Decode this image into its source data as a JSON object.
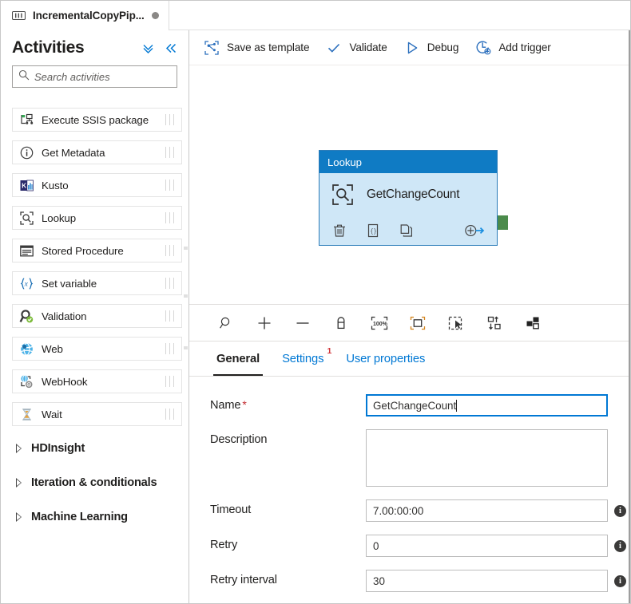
{
  "tab": {
    "title": "IncrementalCopyPip...",
    "icon": "pipeline-icon",
    "dirty_indicator": "unsaved-dot"
  },
  "sidebar": {
    "title": "Activities",
    "collapse_all_icon": "chevron-double-down-icon",
    "collapse_panel_icon": "chevron-double-left-icon",
    "search": {
      "placeholder": "Search activities",
      "value": "",
      "icon": "search-icon"
    },
    "items": [
      {
        "label": "Execute SSIS package",
        "icon": "execute-ssis-package-icon"
      },
      {
        "label": "Get Metadata",
        "icon": "get-metadata-icon"
      },
      {
        "label": "Kusto",
        "icon": "kusto-icon"
      },
      {
        "label": "Lookup",
        "icon": "lookup-icon"
      },
      {
        "label": "Stored Procedure",
        "icon": "stored-procedure-icon"
      },
      {
        "label": "Set variable",
        "icon": "set-variable-icon"
      },
      {
        "label": "Validation",
        "icon": "validation-icon"
      },
      {
        "label": "Web",
        "icon": "web-icon"
      },
      {
        "label": "WebHook",
        "icon": "webhook-icon"
      },
      {
        "label": "Wait",
        "icon": "wait-icon"
      }
    ],
    "groups": [
      {
        "label": "HDInsight",
        "expanded": false
      },
      {
        "label": "Iteration & conditionals",
        "expanded": false
      },
      {
        "label": "Machine Learning",
        "expanded": false
      }
    ]
  },
  "toolbar": {
    "commands": [
      {
        "label": "Save as template",
        "icon": "save-as-template-icon"
      },
      {
        "label": "Validate",
        "icon": "checkmark-icon"
      },
      {
        "label": "Debug",
        "icon": "play-triangle-icon"
      },
      {
        "label": "Add trigger",
        "icon": "add-trigger-icon"
      }
    ]
  },
  "canvas": {
    "node": {
      "type_label": "Lookup",
      "name": "GetChangeCount",
      "icon": "lookup-icon",
      "header_color": "#0f7bc4",
      "body_color": "#cfe7f7",
      "border_color": "#2b7cb9",
      "actions": [
        {
          "name": "delete-icon",
          "label": "Delete"
        },
        {
          "name": "code-view-icon",
          "label": "Code"
        },
        {
          "name": "clone-icon",
          "label": "Clone"
        },
        {
          "name": "add-output-icon",
          "label": "Add output"
        }
      ],
      "status_indicator": {
        "name": "error-circle",
        "color": "#e81123"
      },
      "output_handle": {
        "name": "success-output-handle",
        "color": "#4b8b4b"
      }
    },
    "tools": [
      {
        "icon": "zoom-to-fit-icon"
      },
      {
        "icon": "zoom-in-icon"
      },
      {
        "icon": "zoom-out-icon"
      },
      {
        "icon": "lock-icon"
      },
      {
        "icon": "zoom-100-percent-icon",
        "label": "100%"
      },
      {
        "icon": "fit-to-screen-icon"
      },
      {
        "icon": "select-region-icon"
      },
      {
        "icon": "auto-align-icon"
      },
      {
        "icon": "layout-icon"
      }
    ]
  },
  "properties": {
    "tabs": [
      {
        "label": "General",
        "active": true,
        "badge": null
      },
      {
        "label": "Settings",
        "active": false,
        "badge": "1"
      },
      {
        "label": "User properties",
        "active": false,
        "badge": null
      }
    ],
    "fields": [
      {
        "label": "Name",
        "required": true,
        "value": "GetChangeCount",
        "placeholder": "",
        "type": "text",
        "focused": true,
        "info": false
      },
      {
        "label": "Description",
        "required": false,
        "value": "",
        "placeholder": "",
        "type": "textarea",
        "focused": false,
        "info": false
      },
      {
        "label": "Timeout",
        "required": false,
        "value": "7.00:00:00",
        "placeholder": "",
        "type": "text",
        "focused": false,
        "info": true
      },
      {
        "label": "Retry",
        "required": false,
        "value": "0",
        "placeholder": "",
        "type": "text",
        "focused": false,
        "info": true
      },
      {
        "label": "Retry interval",
        "required": false,
        "value": "30",
        "placeholder": "",
        "type": "text",
        "focused": false,
        "info": true
      }
    ],
    "info_glyph": "i"
  }
}
